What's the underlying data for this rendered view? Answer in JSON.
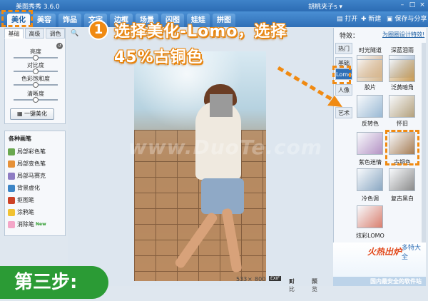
{
  "app": {
    "title": "美图秀秀 3.6.0",
    "user": "胡桃夹子s ▾"
  },
  "window_controls": [
    "–",
    "□",
    "×"
  ],
  "tabs": [
    {
      "label": "美化",
      "active": true
    },
    {
      "label": "美容",
      "active": false
    },
    {
      "label": "饰品",
      "active": false
    },
    {
      "label": "文字",
      "active": false
    },
    {
      "label": "边框",
      "active": false
    },
    {
      "label": "场景",
      "active": false
    },
    {
      "label": "闪图",
      "active": false
    },
    {
      "label": "娃娃",
      "active": false
    },
    {
      "label": "拼图",
      "active": false
    }
  ],
  "top_actions": {
    "open": "打开",
    "new": "新建",
    "save": "保存与分享"
  },
  "left_panel": {
    "subtabs": [
      {
        "label": "基础",
        "active": true
      },
      {
        "label": "高级",
        "active": false
      },
      {
        "label": "调色",
        "active": false
      }
    ],
    "sliders": [
      {
        "label": "亮度",
        "value": 0.5
      },
      {
        "label": "对比度",
        "value": 0.5
      },
      {
        "label": "色彩饱和度",
        "value": 0.5
      },
      {
        "label": "清晰度",
        "value": 0.5
      }
    ],
    "beautify_button": "一键美化"
  },
  "brushes": {
    "title": "各种画笔",
    "items": [
      {
        "label": "局部彩色笔",
        "color": "#6aa84f"
      },
      {
        "label": "局部变色笔",
        "color": "#e69138"
      },
      {
        "label": "局部马赛克",
        "color": "#8e7cc3"
      },
      {
        "label": "背景虚化",
        "color": "#3d85c6"
      },
      {
        "label": "抠图笔",
        "color": "#cc4125"
      },
      {
        "label": "涂鸦笔",
        "color": "#f1c232"
      },
      {
        "label": "消除笔",
        "color": "#f4a6c8",
        "badge": "New"
      }
    ]
  },
  "canvas": {
    "watermark": "www.DuoTe.com",
    "size_w": "533",
    "size_sep": "×",
    "size_h": "800",
    "exif": "EXIF",
    "compare": "对比",
    "preview": "预览"
  },
  "effects": {
    "title": "特效：",
    "link": "为圈圈设计特效!",
    "categories": [
      {
        "label": "热门",
        "active": false
      },
      {
        "label": "基础",
        "active": false
      },
      {
        "label": "Lomo",
        "active": true
      },
      {
        "label": "人像",
        "active": false
      },
      {
        "label": "艺术",
        "active": false
      }
    ],
    "thumbs": [
      {
        "label": "时光隧道",
        "tint": "#c9a27b"
      },
      {
        "label": "深蓝泪雨",
        "tint": "#8fa8c8"
      },
      {
        "label": "胶片",
        "tint": "#d6b68c"
      },
      {
        "label": "泛黄暗角",
        "tint": "#c99a52"
      },
      {
        "label": "反转色",
        "tint": "#9ab9d4"
      },
      {
        "label": "怀旧",
        "tint": "#b3a07c"
      },
      {
        "label": "紫色迷情",
        "tint": "#b493c4"
      },
      {
        "label": "古铜色",
        "tint": "#a57c53"
      },
      {
        "label": "冷色调",
        "tint": "#8aa7c2"
      },
      {
        "label": "复古黑白",
        "tint": "#8a8a8a"
      },
      {
        "label": "炫彩LOMO",
        "tint": "#d97e6e"
      }
    ]
  },
  "ad": {
    "text": "火热出炉",
    "site": "多特大全",
    "bottom": "国内最安全的软件站"
  },
  "annotation": {
    "step_number": "1",
    "line1": "选择美化-Lomo，选择",
    "line2": "45%古铜色",
    "step_banner": "第三步:"
  }
}
